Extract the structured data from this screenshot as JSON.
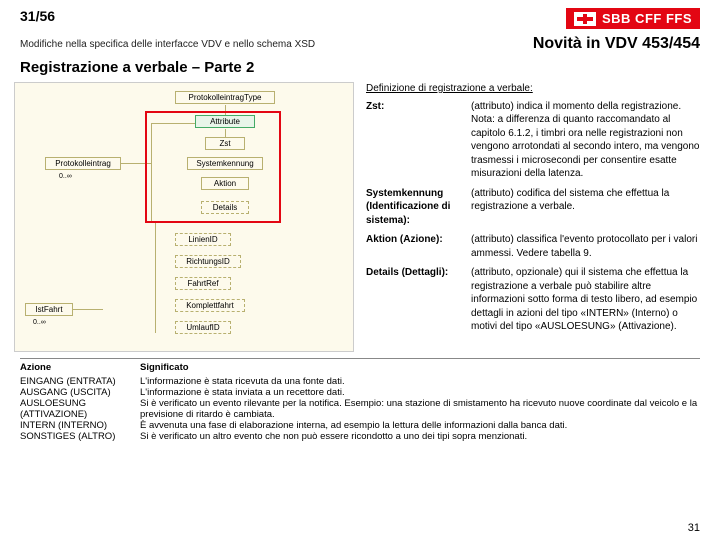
{
  "header": {
    "slide_counter": "31/56",
    "logo_text": "SBB CFF FFS"
  },
  "subtitle": "Modifiche nella specifica delle interfacce VDV e nello schema XSD",
  "title_right": "Novità in VDV 453/454",
  "section_title": "Registrazione a verbale – Parte 2",
  "diagram": {
    "root": "ProtokolleintragType",
    "attr": "Attribute",
    "zst": "Zst",
    "sys": "Systemkennung",
    "aktion": "Aktion",
    "details": "Details",
    "proto": "Protokolleintrag",
    "zero": "0..∞",
    "linien": "LinienID",
    "richt": "RichtungsID",
    "fahrt": "FahrtRef",
    "komplett": "Komplettfahrt",
    "umlauf": "UmlaufID",
    "istfahrt": "IstFahrt",
    "zero2": "0..∞"
  },
  "def_title": "Definizione di registrazione a verbale:",
  "defs": [
    {
      "term": "Zst:",
      "desc": "(attributo) indica il momento della registrazione. Nota: a differenza di quanto raccomandato al capitolo 6.1.2, i timbri ora nelle registrazioni non vengono arrotondati al secondo intero, ma vengono trasmessi i microsecondi per consentire esatte misurazioni della latenza."
    },
    {
      "term": "Systemkennung (Identificazione di sistema):",
      "desc": "(attributo) codifica del sistema che effettua la registrazione a verbale."
    },
    {
      "term": "Aktion (Azione):",
      "desc": "(attributo) classifica l'evento protocollato per i valori ammessi. Vedere tabella 9."
    },
    {
      "term": "Details (Dettagli):",
      "desc": "(attributo, opzionale) qui il sistema che effettua la registrazione a verbale può stabilire altre informazioni sotto forma di testo libero, ad esempio dettagli in azioni del tipo «INTERN» (Interno) o motivi del tipo «AUSLOESUNG» (Attivazione)."
    }
  ],
  "table": {
    "h1": "Azione",
    "h2": "Significato",
    "rows": [
      {
        "a": "EINGANG (ENTRATA)",
        "b": "L'informazione è stata ricevuta da una fonte dati."
      },
      {
        "a": "AUSGANG (USCITA)",
        "b": "L'informazione è stata inviata a un recettore dati."
      },
      {
        "a": "AUSLOESUNG (ATTIVAZIONE)",
        "b": "Si è verificato un evento rilevante per la notifica. Esempio: una stazione di smistamento ha ricevuto nuove coordinate dal veicolo e la previsione di ritardo è cambiata."
      },
      {
        "a": "INTERN (INTERNO)",
        "b": "È avvenuta una fase di elaborazione interna, ad esempio la lettura delle informazioni dalla banca dati."
      },
      {
        "a": "SONSTIGES (ALTRO)",
        "b": "Si è verificato un altro evento che non può essere ricondotto a uno dei tipi sopra menzionati."
      }
    ]
  },
  "page_num": "31"
}
